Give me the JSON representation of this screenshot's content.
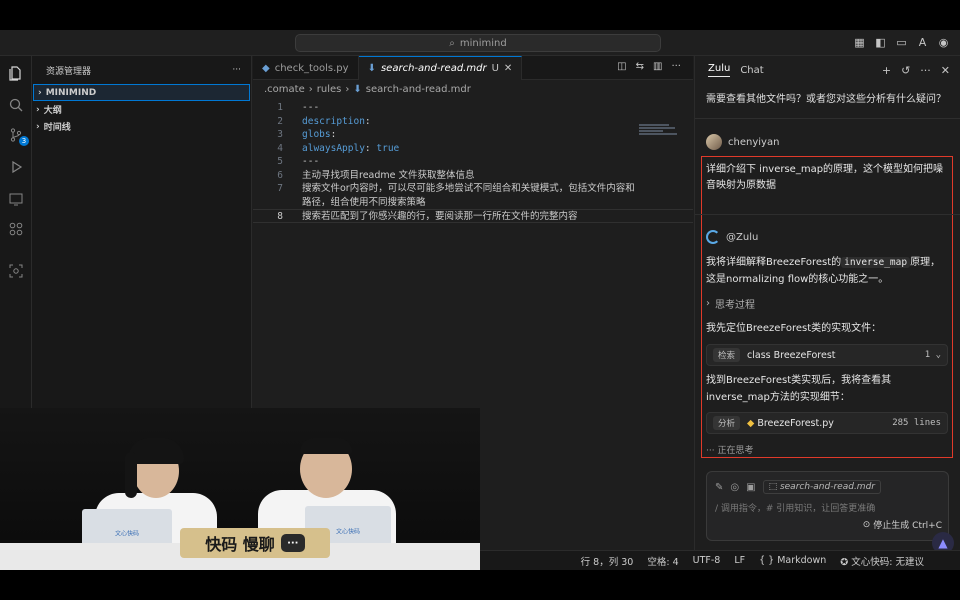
{
  "titlebar": {
    "search": "minimind"
  },
  "activity": {
    "scm_badge": "3"
  },
  "explorer": {
    "title": "资源管理器",
    "more": "···",
    "sections": [
      {
        "label": "MINIMIND",
        "selected": true
      },
      {
        "label": "大纲",
        "selected": false
      },
      {
        "label": "时间线",
        "selected": false
      }
    ]
  },
  "editor": {
    "tabs": [
      {
        "label": "check_tools.py",
        "active": false
      },
      {
        "label": "search-and-read.mdr",
        "active": true,
        "modified": "U"
      }
    ],
    "breadcrumb": [
      ".comate",
      "rules",
      "search-and-read.mdr"
    ],
    "lines": [
      {
        "n": "1",
        "t": "---"
      },
      {
        "n": "2",
        "k": "description",
        "v": ":"
      },
      {
        "n": "3",
        "k": "globs",
        "v": ":"
      },
      {
        "n": "4",
        "k": "alwaysApply",
        "v": ": ",
        "b": "true"
      },
      {
        "n": "5",
        "t": "---"
      },
      {
        "n": "6",
        "t": "主动寻找项目readme 文件获取整体信息"
      },
      {
        "n": "7",
        "t": "搜索文件or内容时，可以尽可能多地尝试不同组合和关键模式，包括文件内容和"
      },
      {
        "n": "",
        "t": "路径，组合使用不同搜索策略"
      },
      {
        "n": "8",
        "t": "搜索若匹配到了你感兴趣的行，要阅读那一行所在文件的完整内容"
      }
    ]
  },
  "chat": {
    "tabs": [
      "Zulu",
      "Chat"
    ],
    "prev_message": "需要查看其他文件吗？或者您对这些分析有什么疑问？",
    "user_name": "chenyiyan",
    "question": "详细介绍下 inverse_map的原理，这个模型如何把噪音映射为原数据",
    "bot_name": "@Zulu",
    "answer1_pre": "我将详细解释BreezeForest的",
    "answer1_code": "inverse_map",
    "answer1_post": "原理，这是normalizing flow的核心功能之一。",
    "think_label": "思考过程",
    "answer2": "我先定位BreezeForest类的实现文件：",
    "tool1": {
      "label": "检索",
      "text": "class BreezeForest",
      "count": "1"
    },
    "answer3": "找到BreezeForest类实现后，我将查看其inverse_map方法的实现细节：",
    "tool2": {
      "label": "分析",
      "text": "BreezeForest.py",
      "lines": "285 lines"
    },
    "thinking": "正在思考",
    "input": {
      "file_chip": "search-and-read.mdr",
      "placeholder": "/ 调用指令，# 引用知识，让回答更准确",
      "stop": "停止生成 Ctrl+C"
    }
  },
  "statusbar": {
    "position": "行 8，列 30",
    "spaces": "空格: 4",
    "encoding": "UTF-8",
    "eol": "LF",
    "language": "Markdown",
    "plugin": "文心快码: 无建议"
  },
  "video": {
    "brand": "快码 慢聊",
    "laptop_text": "文心快码"
  },
  "colors": {
    "accent": "#0078d4",
    "highlight": "#e03a2a"
  }
}
